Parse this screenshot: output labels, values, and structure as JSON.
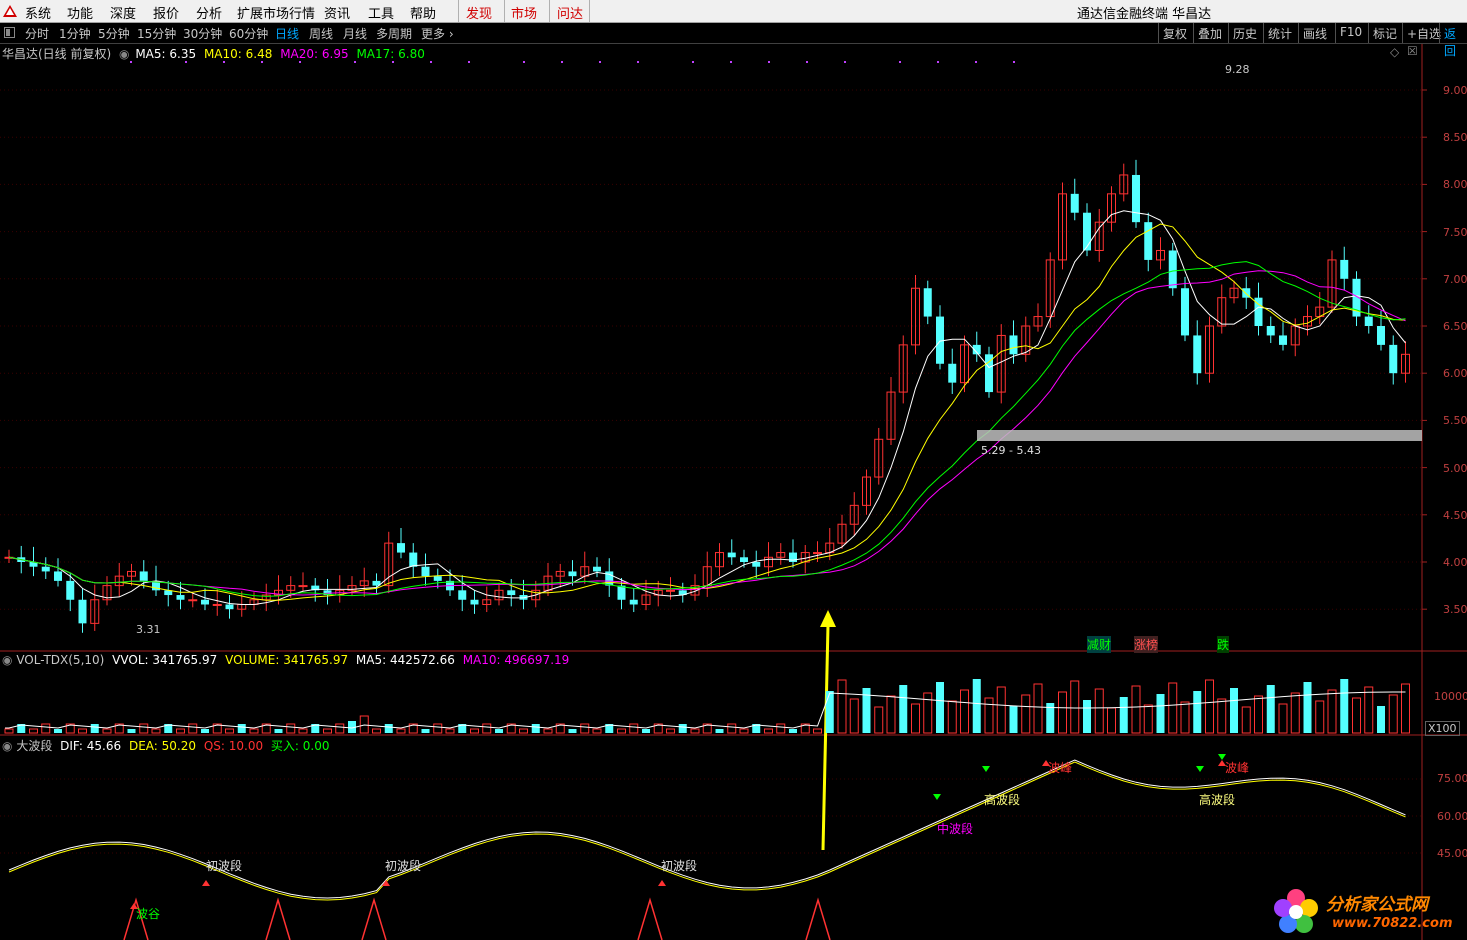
{
  "menu": {
    "items": [
      "系统",
      "功能",
      "深度",
      "报价",
      "分析",
      "扩展市场行情",
      "资讯",
      "工具",
      "帮助"
    ],
    "highlights": [
      "发现",
      "市场",
      "问达"
    ],
    "window_title": "通达信金融终端",
    "stock_name": "华昌达"
  },
  "periods": [
    "分时",
    "1分钟",
    "5分钟",
    "15分钟",
    "30分钟",
    "60分钟",
    "日线",
    "周线",
    "月线",
    "多周期",
    "更多"
  ],
  "active_period": "日线",
  "right_tools": [
    "复权",
    "叠加",
    "历史",
    "统计",
    "画线",
    "F10",
    "标记",
    "+自选",
    "返回"
  ],
  "main_panel": {
    "title": "华昌达(日线 前复权)",
    "ma5": "MA5: 6.35",
    "ma10": "MA10: 6.48",
    "ma20": "MA20: 6.95",
    "ma17": "MA17: 6.80",
    "y_ticks": [
      "9.00",
      "8.50",
      "8.00",
      "7.50",
      "7.00",
      "6.50",
      "6.00",
      "5.50",
      "5.00",
      "4.50",
      "4.00",
      "3.50"
    ],
    "high_label": "9.28",
    "low_label": "3.31",
    "band_label": "5.29 - 5.43",
    "event_tags": [
      "减财",
      "涨榜",
      "跌"
    ]
  },
  "vol_panel": {
    "title": "VOL-TDX(5,10)",
    "vvol": "VVOL: 341765.97",
    "volume": "VOLUME: 341765.97",
    "ma5": "MA5: 442572.66",
    "ma10": "MA10: 496697.19",
    "y_tick": "10000",
    "unit": "X100"
  },
  "ind_panel": {
    "title": "大波段",
    "dif": "DIF: 45.66",
    "dea": "DEA: 50.20",
    "qs": "QS: 10.00",
    "buy": "买入: 0.00",
    "y_ticks": [
      "75.00",
      "60.00",
      "45.00"
    ],
    "labels": {
      "bogu": "波谷",
      "chubo1": "初波段",
      "chubo2": "初波段",
      "chubo3": "初波段",
      "zhongbo": "中波段",
      "gaobo1": "高波段",
      "gaobo2": "高波段",
      "bofeng1": "波峰",
      "bofeng2": "波峰"
    }
  },
  "watermark": {
    "line1": "分析家公式网",
    "line2": "www.70822.com"
  },
  "colors": {
    "up": "#ff3232",
    "down": "#54ffff",
    "ma5": "#ffffff",
    "ma10": "#ffff00",
    "ma20": "#ff00ff",
    "ma17": "#00ff00"
  }
}
